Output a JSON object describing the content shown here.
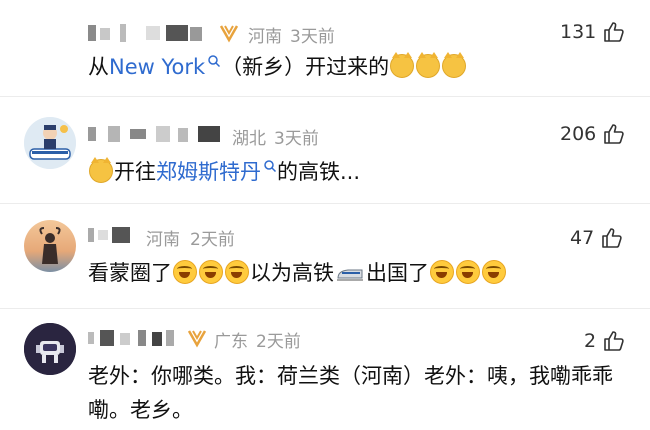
{
  "comments": [
    {
      "location": "河南",
      "time": "3天前",
      "likes": "131",
      "has_vip": true,
      "text_parts": [
        "从",
        "New York",
        "（新乡）开过来的"
      ],
      "emoji_after": [
        "cat-face",
        "cat-face",
        "cat-face"
      ]
    },
    {
      "location": "湖北",
      "time": "3天前",
      "likes": "206",
      "has_vip": false,
      "emoji_before": "cat-face",
      "text_parts": [
        "开往",
        "郑姆斯特丹",
        "的高铁..."
      ]
    },
    {
      "location": "河南",
      "time": "2天前",
      "likes": "47",
      "has_vip": false,
      "text_parts": [
        "看蒙圈了",
        "以为高铁",
        "出国了"
      ],
      "emoji_names": [
        "laugh-cry",
        "bullet-train"
      ]
    },
    {
      "location": "广东",
      "time": "2天前",
      "likes": "2",
      "has_vip": true,
      "text": "老外：你哪类。我：荷兰类（河南）老外：咦，我嘞乖乖嘞。老乡。"
    }
  ],
  "colors": {
    "link": "#2f6bcf",
    "meta": "#9a9a9a",
    "vip": "#e8a33d"
  },
  "icons": [
    "thumbs-up-icon",
    "search-icon",
    "vip-icon"
  ]
}
